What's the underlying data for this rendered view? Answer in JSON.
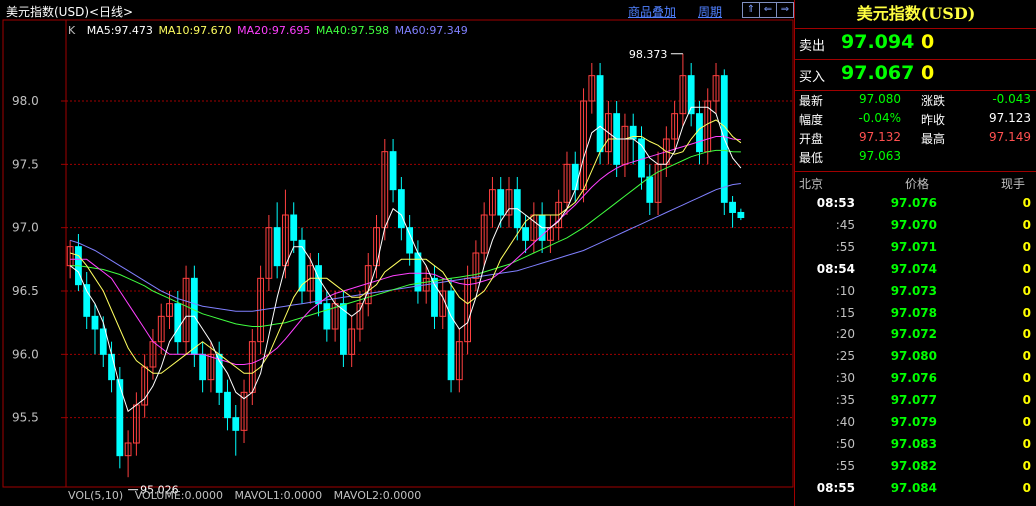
{
  "chart": {
    "title": "美元指数(USD)<日线>",
    "overlay_link": "商品叠加",
    "period_link": "周期",
    "nav_buttons": [
      "⇑",
      "⇐",
      "⇒"
    ],
    "k_label": "K",
    "ma_legend": [
      {
        "text": "MA5:97.473",
        "color": "#ffffff"
      },
      {
        "text": "MA10:97.670",
        "color": "#ffff60"
      },
      {
        "text": "MA20:97.695",
        "color": "#ff40ff"
      },
      {
        "text": "MA40:97.598",
        "color": "#40ff40"
      },
      {
        "text": "MA60:97.349",
        "color": "#8080ff"
      }
    ],
    "vol_legend": [
      "VOL(5,10)",
      "VOLUME:0.0000",
      "MAVOL1:0.0000",
      "MAVOL2:0.0000"
    ],
    "annotations": {
      "high": "98.373",
      "low": "95.026"
    }
  },
  "chart_data": {
    "type": "candlestick",
    "yticks": [
      "98.0",
      "97.5",
      "97.0",
      "96.5",
      "96.0",
      "95.5"
    ],
    "ylim": [
      95.0,
      98.6
    ],
    "colors": {
      "up": "#ff4040",
      "down": "#00ffff",
      "grid": "#a00000",
      "ma5": "#ffffff",
      "ma10": "#ffff60",
      "ma20": "#ff40ff",
      "ma40": "#40ff40",
      "ma60": "#8080ff"
    },
    "high_mark": 98.373,
    "low_mark": 95.026,
    "candles": [
      [
        96.7,
        96.85,
        96.9,
        96.6
      ],
      [
        96.85,
        96.55,
        96.95,
        96.5
      ],
      [
        96.55,
        96.3,
        96.65,
        96.2
      ],
      [
        96.3,
        96.2,
        96.4,
        96.0
      ],
      [
        96.2,
        96.0,
        96.3,
        95.9
      ],
      [
        96.0,
        95.8,
        96.1,
        95.7
      ],
      [
        95.8,
        95.2,
        95.9,
        95.1
      ],
      [
        95.2,
        95.3,
        95.4,
        95.03
      ],
      [
        95.3,
        95.6,
        95.7,
        95.2
      ],
      [
        95.6,
        95.9,
        96.0,
        95.5
      ],
      [
        95.9,
        96.1,
        96.2,
        95.8
      ],
      [
        96.1,
        96.3,
        96.4,
        96.0
      ],
      [
        96.3,
        96.4,
        96.5,
        96.2
      ],
      [
        96.4,
        96.1,
        96.5,
        96.0
      ],
      [
        96.1,
        96.6,
        96.7,
        96.0
      ],
      [
        96.6,
        96.0,
        96.7,
        95.9
      ],
      [
        96.0,
        95.8,
        96.1,
        95.7
      ],
      [
        95.8,
        96.0,
        96.1,
        95.7
      ],
      [
        96.0,
        95.7,
        96.1,
        95.6
      ],
      [
        95.7,
        95.5,
        95.8,
        95.4
      ],
      [
        95.5,
        95.4,
        95.6,
        95.2
      ],
      [
        95.4,
        95.7,
        95.8,
        95.3
      ],
      [
        95.7,
        96.1,
        96.2,
        95.6
      ],
      [
        96.1,
        96.6,
        96.7,
        96.0
      ],
      [
        96.6,
        97.0,
        97.1,
        96.5
      ],
      [
        97.0,
        96.7,
        97.2,
        96.6
      ],
      [
        96.7,
        97.1,
        97.3,
        96.6
      ],
      [
        97.1,
        96.9,
        97.2,
        96.8
      ],
      [
        96.9,
        96.5,
        97.0,
        96.4
      ],
      [
        96.5,
        96.7,
        96.8,
        96.4
      ],
      [
        96.7,
        96.4,
        96.8,
        96.3
      ],
      [
        96.4,
        96.2,
        96.5,
        96.1
      ],
      [
        96.2,
        96.4,
        96.5,
        96.1
      ],
      [
        96.4,
        96.0,
        96.5,
        95.9
      ],
      [
        96.0,
        96.2,
        96.3,
        95.9
      ],
      [
        96.2,
        96.4,
        96.5,
        96.1
      ],
      [
        96.4,
        96.7,
        96.8,
        96.3
      ],
      [
        96.7,
        97.0,
        97.1,
        96.6
      ],
      [
        97.0,
        97.6,
        97.7,
        96.9
      ],
      [
        97.6,
        97.3,
        97.7,
        97.2
      ],
      [
        97.3,
        97.0,
        97.4,
        96.9
      ],
      [
        97.0,
        96.8,
        97.1,
        96.7
      ],
      [
        96.8,
        96.5,
        96.9,
        96.4
      ],
      [
        96.5,
        96.6,
        96.7,
        96.4
      ],
      [
        96.6,
        96.3,
        96.7,
        96.2
      ],
      [
        96.3,
        96.5,
        96.6,
        96.2
      ],
      [
        96.5,
        95.8,
        96.6,
        95.7
      ],
      [
        95.8,
        96.1,
        96.2,
        95.7
      ],
      [
        96.1,
        96.6,
        96.7,
        96.0
      ],
      [
        96.6,
        96.8,
        96.9,
        96.5
      ],
      [
        96.8,
        97.1,
        97.2,
        96.7
      ],
      [
        97.1,
        97.3,
        97.4,
        97.0
      ],
      [
        97.3,
        97.1,
        97.4,
        97.0
      ],
      [
        97.1,
        97.3,
        97.4,
        97.0
      ],
      [
        97.3,
        97.0,
        97.4,
        96.9
      ],
      [
        97.0,
        96.9,
        97.1,
        96.8
      ],
      [
        96.9,
        97.1,
        97.2,
        96.8
      ],
      [
        97.1,
        96.9,
        97.2,
        96.8
      ],
      [
        96.9,
        97.0,
        97.1,
        96.8
      ],
      [
        97.0,
        97.2,
        97.3,
        96.9
      ],
      [
        97.2,
        97.5,
        97.6,
        97.1
      ],
      [
        97.5,
        97.3,
        97.6,
        97.2
      ],
      [
        97.3,
        98.0,
        98.1,
        97.2
      ],
      [
        98.0,
        98.2,
        98.3,
        97.9
      ],
      [
        98.2,
        97.6,
        98.3,
        97.5
      ],
      [
        97.6,
        97.9,
        98.0,
        97.5
      ],
      [
        97.9,
        97.5,
        98.0,
        97.4
      ],
      [
        97.5,
        97.8,
        97.9,
        97.4
      ],
      [
        97.8,
        97.7,
        97.9,
        97.5
      ],
      [
        97.7,
        97.4,
        97.8,
        97.3
      ],
      [
        97.4,
        97.2,
        97.5,
        97.1
      ],
      [
        97.2,
        97.5,
        97.6,
        97.1
      ],
      [
        97.5,
        97.7,
        97.8,
        97.4
      ],
      [
        97.7,
        97.9,
        98.0,
        97.6
      ],
      [
        97.9,
        98.2,
        98.373,
        97.8
      ],
      [
        98.2,
        97.9,
        98.3,
        97.8
      ],
      [
        97.9,
        97.6,
        98.0,
        97.5
      ],
      [
        97.6,
        98.0,
        98.1,
        97.5
      ],
      [
        98.0,
        98.2,
        98.3,
        97.9
      ],
      [
        98.2,
        97.2,
        98.25,
        97.1
      ],
      [
        97.2,
        97.12,
        97.25,
        97.0
      ],
      [
        97.12,
        97.08,
        97.15,
        97.06
      ]
    ],
    "ma5": [
      96.7,
      96.65,
      96.5,
      96.4,
      96.25,
      96.0,
      95.75,
      95.55,
      95.6,
      95.65,
      95.75,
      95.9,
      96.1,
      96.2,
      96.3,
      96.3,
      96.2,
      96.1,
      95.95,
      95.85,
      95.7,
      95.65,
      95.7,
      95.85,
      96.15,
      96.45,
      96.7,
      96.85,
      96.85,
      96.75,
      96.6,
      96.5,
      96.4,
      96.35,
      96.3,
      96.35,
      96.5,
      96.7,
      97.0,
      97.15,
      97.1,
      96.95,
      96.8,
      96.7,
      96.55,
      96.45,
      96.3,
      96.2,
      96.25,
      96.45,
      96.7,
      96.9,
      97.05,
      97.15,
      97.15,
      97.1,
      97.05,
      97.0,
      97.0,
      97.05,
      97.15,
      97.3,
      97.55,
      97.75,
      97.8,
      97.75,
      97.7,
      97.7,
      97.7,
      97.65,
      97.55,
      97.5,
      97.5,
      97.6,
      97.8,
      97.95,
      97.95,
      97.95,
      97.9,
      97.7,
      97.55,
      97.47
    ],
    "ma10": [
      96.8,
      96.78,
      96.7,
      96.6,
      96.5,
      96.35,
      96.2,
      96.05,
      95.95,
      95.9,
      95.85,
      95.85,
      95.9,
      95.95,
      96.0,
      96.05,
      96.1,
      96.05,
      96.0,
      95.95,
      95.9,
      95.85,
      95.85,
      95.9,
      96.0,
      96.15,
      96.3,
      96.45,
      96.55,
      96.6,
      96.6,
      96.6,
      96.55,
      96.5,
      96.45,
      96.45,
      96.5,
      96.55,
      96.65,
      96.7,
      96.75,
      96.75,
      96.75,
      96.75,
      96.7,
      96.65,
      96.55,
      96.45,
      96.4,
      96.45,
      96.5,
      96.6,
      96.75,
      96.85,
      96.95,
      97.05,
      97.1,
      97.1,
      97.1,
      97.1,
      97.15,
      97.2,
      97.3,
      97.45,
      97.6,
      97.7,
      97.7,
      97.7,
      97.72,
      97.72,
      97.68,
      97.65,
      97.6,
      97.58,
      97.6,
      97.7,
      97.78,
      97.82,
      97.85,
      97.8,
      97.72,
      97.67
    ],
    "ma20": [
      96.75,
      96.75,
      96.75,
      96.7,
      96.65,
      96.6,
      96.5,
      96.4,
      96.3,
      96.2,
      96.1,
      96.05,
      96.0,
      96.0,
      96.0,
      96.0,
      96.0,
      95.98,
      95.96,
      95.94,
      95.92,
      95.92,
      95.93,
      95.96,
      96.0,
      96.05,
      96.12,
      96.2,
      96.28,
      96.35,
      96.4,
      96.45,
      96.48,
      96.5,
      96.52,
      96.54,
      96.56,
      96.58,
      96.6,
      96.62,
      96.63,
      96.64,
      96.64,
      96.64,
      96.63,
      96.6,
      96.58,
      96.56,
      96.55,
      96.56,
      96.58,
      96.6,
      96.65,
      96.7,
      96.76,
      96.82,
      96.88,
      96.94,
      97.0,
      97.06,
      97.12,
      97.18,
      97.25,
      97.32,
      97.38,
      97.43,
      97.47,
      97.5,
      97.52,
      97.54,
      97.56,
      97.58,
      97.6,
      97.62,
      97.64,
      97.66,
      97.68,
      97.7,
      97.72,
      97.72,
      97.7,
      97.695
    ],
    "ma40": [
      96.7,
      96.7,
      96.69,
      96.68,
      96.67,
      96.65,
      96.63,
      96.6,
      96.57,
      96.54,
      96.5,
      96.47,
      96.44,
      96.41,
      96.38,
      96.35,
      96.32,
      96.3,
      96.28,
      96.26,
      96.24,
      96.23,
      96.22,
      96.22,
      96.23,
      96.24,
      96.25,
      96.27,
      96.29,
      96.31,
      96.33,
      96.35,
      96.37,
      96.39,
      96.41,
      96.43,
      96.45,
      96.47,
      96.49,
      96.51,
      96.53,
      96.55,
      96.56,
      96.57,
      96.58,
      96.59,
      96.6,
      96.61,
      96.62,
      96.63,
      96.65,
      96.67,
      96.69,
      96.71,
      96.74,
      96.77,
      96.8,
      96.83,
      96.86,
      96.89,
      96.92,
      96.96,
      97.0,
      97.05,
      97.1,
      97.15,
      97.2,
      97.25,
      97.3,
      97.35,
      97.4,
      97.44,
      97.47,
      97.5,
      97.53,
      97.56,
      97.58,
      97.6,
      97.61,
      97.61,
      97.6,
      97.598
    ],
    "ma60": [
      96.9,
      96.88,
      96.85,
      96.82,
      96.78,
      96.74,
      96.7,
      96.66,
      96.62,
      96.58,
      96.54,
      96.5,
      96.47,
      96.44,
      96.42,
      96.4,
      96.38,
      96.37,
      96.36,
      96.35,
      96.34,
      96.34,
      96.34,
      96.35,
      96.36,
      96.37,
      96.38,
      96.39,
      96.4,
      96.41,
      96.42,
      96.43,
      96.44,
      96.45,
      96.46,
      96.47,
      96.48,
      96.49,
      96.5,
      96.51,
      96.52,
      96.53,
      96.54,
      96.55,
      96.56,
      96.57,
      96.58,
      96.59,
      96.6,
      96.61,
      96.62,
      96.63,
      96.64,
      96.65,
      96.66,
      96.68,
      96.7,
      96.72,
      96.74,
      96.76,
      96.78,
      96.8,
      96.82,
      96.85,
      96.88,
      96.91,
      96.94,
      96.97,
      97.0,
      97.03,
      97.06,
      97.09,
      97.12,
      97.15,
      97.18,
      97.21,
      97.24,
      97.27,
      97.3,
      97.32,
      97.34,
      97.349
    ]
  },
  "quote": {
    "title": "美元指数(USD)",
    "sell_label": "卖出",
    "sell_price": "97.094",
    "sell_vol": "0",
    "buy_label": "买入",
    "buy_price": "97.067",
    "buy_vol": "0",
    "stats": [
      {
        "l1": "最新",
        "v1": "97.080",
        "c1": "green",
        "l2": "涨跌",
        "v2": "-0.043",
        "c2": "green"
      },
      {
        "l1": "幅度",
        "v1": "-0.04%",
        "c1": "green",
        "l2": "昨收",
        "v2": "97.123",
        "c2": "white"
      },
      {
        "l1": "开盘",
        "v1": "97.132",
        "c1": "red",
        "l2": "最高",
        "v2": "97.149",
        "c2": "red"
      },
      {
        "l1": "最低",
        "v1": "97.063",
        "c1": "green",
        "l2": "",
        "v2": "",
        "c2": "white"
      }
    ],
    "ticks_header": {
      "time": "北京",
      "price": "价格",
      "vol": "现手"
    },
    "ticks": [
      {
        "time": "08:53",
        "price": "97.076",
        "vol": "0",
        "major": true
      },
      {
        "time": ":45",
        "price": "97.070",
        "vol": "0",
        "major": false
      },
      {
        "time": ":55",
        "price": "97.071",
        "vol": "0",
        "major": false
      },
      {
        "time": "08:54",
        "price": "97.074",
        "vol": "0",
        "major": true
      },
      {
        "time": ":10",
        "price": "97.073",
        "vol": "0",
        "major": false
      },
      {
        "time": ":15",
        "price": "97.078",
        "vol": "0",
        "major": false
      },
      {
        "time": ":20",
        "price": "97.072",
        "vol": "0",
        "major": false
      },
      {
        "time": ":25",
        "price": "97.080",
        "vol": "0",
        "major": false
      },
      {
        "time": ":30",
        "price": "97.076",
        "vol": "0",
        "major": false
      },
      {
        "time": ":35",
        "price": "97.077",
        "vol": "0",
        "major": false
      },
      {
        "time": ":40",
        "price": "97.079",
        "vol": "0",
        "major": false
      },
      {
        "time": ":50",
        "price": "97.083",
        "vol": "0",
        "major": false
      },
      {
        "time": ":55",
        "price": "97.082",
        "vol": "0",
        "major": false
      },
      {
        "time": "08:55",
        "price": "97.084",
        "vol": "0",
        "major": true
      }
    ]
  }
}
